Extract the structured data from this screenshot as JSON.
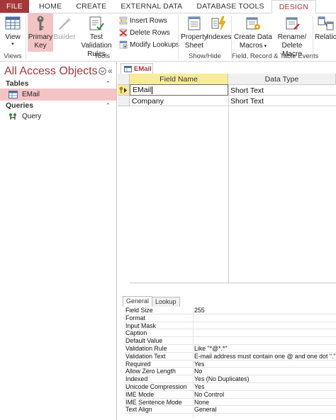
{
  "tabs": [
    "FILE",
    "HOME",
    "CREATE",
    "EXTERNAL DATA",
    "DATABASE TOOLS",
    "DESIGN"
  ],
  "ribbon": {
    "views_group": "Views",
    "view_label": "View",
    "tools_group": "Tools",
    "primary_key_l1": "Primary",
    "primary_key_l2": "Key",
    "builder": "Builder",
    "test_validation_l1": "Test Validation",
    "test_validation_l2": "Rules",
    "insert_rows": "Insert Rows",
    "delete_rows": "Delete Rows",
    "modify_lookups": "Modify Lookups",
    "showhide_group": "Show/Hide",
    "property_sheet_l1": "Property",
    "property_sheet_l2": "Sheet",
    "indexes": "Indexes",
    "field_events_group": "Field, Record & Table Events",
    "create_macros_l1": "Create Data",
    "create_macros_l2": "Macros",
    "rename_macro_l1": "Rename/",
    "rename_macro_l2": "Delete Macro",
    "relationships": "Relatio"
  },
  "nav": {
    "title": "All Access Objects",
    "tables_header": "Tables",
    "tables": [
      "EMail"
    ],
    "queries_header": "Queries",
    "queries": [
      "Query"
    ]
  },
  "doc": {
    "tab": "EMail",
    "col_field": "Field Name",
    "col_type": "Data Type",
    "rows": [
      {
        "field": "EMail",
        "type": "Short Text"
      },
      {
        "field": "Company",
        "type": "Short Text"
      }
    ]
  },
  "props": {
    "tab_general": "General",
    "tab_lookup": "Lookup",
    "rows": [
      {
        "name": "Field Size",
        "value": "255"
      },
      {
        "name": "Format",
        "value": ""
      },
      {
        "name": "Input Mask",
        "value": ""
      },
      {
        "name": "Caption",
        "value": ""
      },
      {
        "name": "Default Value",
        "value": ""
      },
      {
        "name": "Validation Rule",
        "value": "Like \"*@*.*\""
      },
      {
        "name": "Validation Text",
        "value": "E-mail address must contain one @ and one dot \".\""
      },
      {
        "name": "Required",
        "value": "Yes"
      },
      {
        "name": "Allow Zero Length",
        "value": "No"
      },
      {
        "name": "Indexed",
        "value": "Yes (No Duplicates)"
      },
      {
        "name": "Unicode Compression",
        "value": "Yes"
      },
      {
        "name": "IME Mode",
        "value": "No Control"
      },
      {
        "name": "IME Sentence Mode",
        "value": "None"
      },
      {
        "name": "Text Align",
        "value": "General"
      }
    ]
  },
  "colors": {
    "accent": "#a4373a",
    "selection": "#f4c4c4",
    "header_selected": "#f9eb99"
  }
}
